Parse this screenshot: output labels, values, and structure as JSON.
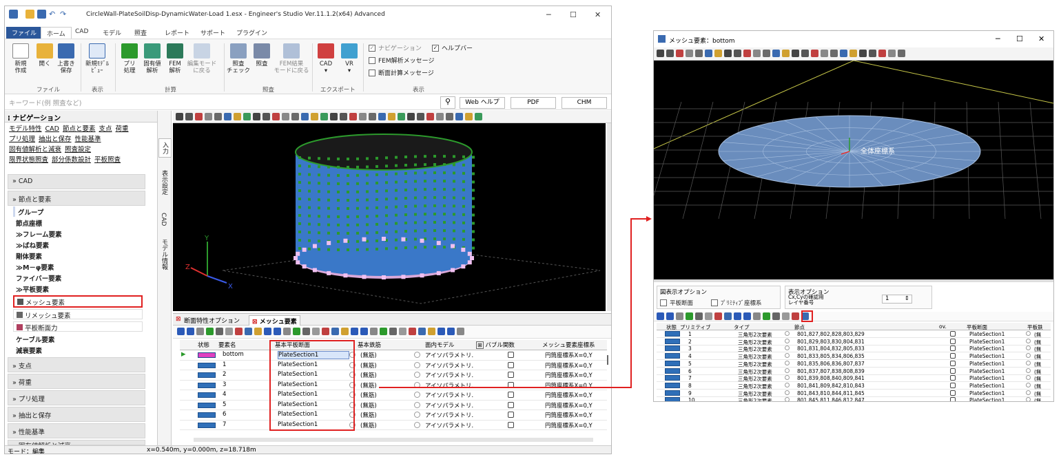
{
  "main_window": {
    "title": "CircleWall-PlateSoilDisp-DynamicWater-Load 1.esx - Engineer's Studio Ver.11.1.2(x64) Advanced",
    "controls": {
      "min": "─",
      "max": "☐",
      "close": "✕"
    },
    "tabs": [
      "ファイル",
      "ホーム",
      "CAD",
      "モデル",
      "照査",
      "レポート",
      "サポート",
      "プラグイン"
    ],
    "ribbon": {
      "groups": [
        {
          "label": "ファイル",
          "buttons": [
            {
              "label": "新規\n作成",
              "icon": "new-file-icon"
            },
            {
              "label": "開く",
              "icon": "open-folder-icon"
            },
            {
              "label": "上書き\n保存",
              "icon": "save-icon"
            }
          ]
        },
        {
          "label": "表示",
          "buttons": [
            {
              "label": "新規ﾓﾃﾞﾙ\nﾋﾞｭｰ",
              "icon": "model-view-icon"
            }
          ]
        },
        {
          "label": "計算",
          "buttons": [
            {
              "label": "プリ\n処理",
              "icon": "preprocess-icon"
            },
            {
              "label": "固有値\n解析",
              "icon": "eigen-icon"
            },
            {
              "label": "FEM\n解析",
              "icon": "fem-icon"
            },
            {
              "label": "編集モード\nに戻る",
              "icon": "edit-mode-icon"
            }
          ]
        },
        {
          "label": "照査",
          "buttons": [
            {
              "label": "照査\nチェック",
              "icon": "check-icon"
            },
            {
              "label": "照査",
              "icon": "verify-icon"
            },
            {
              "label": "FEM結果\nモードに戻る",
              "icon": "fem-result-icon"
            }
          ]
        },
        {
          "label": "エクスポート",
          "buttons": [
            {
              "label": "CAD",
              "icon": "cad-icon"
            },
            {
              "label": "VR",
              "icon": "vr-icon"
            }
          ]
        },
        {
          "label": "表示",
          "checks": [
            {
              "label": "ナビゲーション",
              "checked": true
            },
            {
              "label": "ヘルプバー",
              "checked": true
            },
            {
              "label": "FEM解析メッセージ",
              "checked": false
            },
            {
              "label": "断面計算メッセージ",
              "checked": false
            }
          ]
        }
      ]
    },
    "search": {
      "placeholder": "キーワード(例 照査など)",
      "buttons": [
        "Web ヘルプ",
        "PDF",
        "CHM"
      ]
    },
    "navigation": {
      "title": "ナビゲーション",
      "links": [
        [
          "モデル特性",
          "CAD",
          "節点と要素",
          "支点",
          "荷重"
        ],
        [
          "プリ処理",
          "抽出と保存",
          "性能基準"
        ],
        [
          "固有値解析と減衰",
          "照査設定"
        ],
        [
          "限界状態照査",
          "部分係数設計",
          "平板照査"
        ]
      ],
      "sections": [
        "» CAD",
        "» 節点と要素"
      ],
      "items": [
        "グループ",
        "節点座標",
        "≫フレーム要素",
        "≫ばね要素",
        "剛体要素",
        "≫M－φ要素",
        "ファイバー要素",
        "≫平板要素",
        "メッシュ要素",
        "リメッシュ要素",
        "平板断面力",
        "ケーブル要素",
        "減衰要素"
      ],
      "bottom_sections": [
        "» 支点",
        "» 荷重",
        "» プリ処理",
        "» 抽出と保存",
        "» 性能基準",
        "» 固有値解析と減衰"
      ]
    },
    "side_tabs": [
      "入力",
      "表示設定",
      "CAD",
      "モデル情報"
    ],
    "bottom_panel": {
      "tabs": [
        "断面特性オプション",
        "メッシュ要素"
      ],
      "columns": [
        "状態",
        "要素名",
        "基本平板断面",
        "基本鉄筋",
        "面内モデル",
        "バブル関数",
        "メッシュ要素座標系"
      ],
      "rows": [
        {
          "name": "bottom",
          "section": "PlateSection1",
          "rebar": "(無筋)",
          "model": "アイソパラメトリ…",
          "coord": "円筒座標系X=0,Y"
        },
        {
          "name": "1",
          "section": "PlateSection1",
          "rebar": "(無筋)",
          "model": "アイソパラメトリ…",
          "coord": "円筒座標系X=0,Y"
        },
        {
          "name": "2",
          "section": "PlateSection1",
          "rebar": "(無筋)",
          "model": "アイソパラメトリ…",
          "coord": "円筒座標系X=0,Y"
        },
        {
          "name": "3",
          "section": "PlateSection1",
          "rebar": "(無筋)",
          "model": "アイソパラメトリ…",
          "coord": "円筒座標系X=0,Y"
        },
        {
          "name": "4",
          "section": "PlateSection1",
          "rebar": "(無筋)",
          "model": "アイソパラメトリ…",
          "coord": "円筒座標系X=0,Y"
        },
        {
          "name": "5",
          "section": "PlateSection1",
          "rebar": "(無筋)",
          "model": "アイソパラメトリ…",
          "coord": "円筒座標系X=0,Y"
        },
        {
          "name": "6",
          "section": "PlateSection1",
          "rebar": "(無筋)",
          "model": "アイソパラメトリ…",
          "coord": "円筒座標系X=0,Y"
        },
        {
          "name": "7",
          "section": "PlateSection1",
          "rebar": "(無筋)",
          "model": "アイソパラメトリ…",
          "coord": "円筒座標系X=0,Y"
        }
      ]
    },
    "status": {
      "mode": "モード：編集",
      "coords": "x=0.540m, y=0.000m, z=18.718m"
    },
    "axis": {
      "x": "X",
      "y": "Y",
      "z": "Z"
    }
  },
  "sub_window": {
    "title": "メッシュ要素：bottom",
    "view_label": "全体座標系",
    "options": {
      "group1_title": "図表示オプション",
      "plate_section": "平板断面",
      "primitive_coord": "ﾌﾟﾘﾐﾃｨﾌﾞ座標系",
      "group2_title": "表示オプション",
      "cxcy_label": "Cx,Cyの確認用\nレイヤ番号",
      "spin_value": "1"
    },
    "columns": [
      "状態",
      "プリミティブ",
      "タイプ",
      "節点",
      "ov.",
      "平板断面",
      "平板鉄"
    ],
    "rows": [
      {
        "id": "1",
        "type": "三角形2次要素",
        "nodes": "801,827,802,828,803,829",
        "section": "PlateSection1"
      },
      {
        "id": "2",
        "type": "三角形2次要素",
        "nodes": "801,829,803,830,804,831",
        "section": "PlateSection1"
      },
      {
        "id": "3",
        "type": "三角形2次要素",
        "nodes": "801,831,804,832,805,833",
        "section": "PlateSection1"
      },
      {
        "id": "4",
        "type": "三角形2次要素",
        "nodes": "801,833,805,834,806,835",
        "section": "PlateSection1"
      },
      {
        "id": "5",
        "type": "三角形2次要素",
        "nodes": "801,835,806,836,807,837",
        "section": "PlateSection1"
      },
      {
        "id": "6",
        "type": "三角形2次要素",
        "nodes": "801,837,807,838,808,839",
        "section": "PlateSection1"
      },
      {
        "id": "7",
        "type": "三角形2次要素",
        "nodes": "801,839,808,840,809,841",
        "section": "PlateSection1"
      },
      {
        "id": "8",
        "type": "三角形2次要素",
        "nodes": "801,841,809,842,810,843",
        "section": "PlateSection1"
      },
      {
        "id": "9",
        "type": "三角形2次要素",
        "nodes": "801,843,810,844,811,845",
        "section": "PlateSection1"
      },
      {
        "id": "10",
        "type": "三角形2次要素",
        "nodes": "801,845,811,846,812,847",
        "section": "PlateSection1"
      }
    ],
    "rebar_short": "(無"
  },
  "colors": {
    "highlight": "#e02020",
    "accent": "#2b579a",
    "mesh_blue": "#3a78c8",
    "node_green": "#2c9a2c",
    "support_pink": "#e0a0e0"
  }
}
